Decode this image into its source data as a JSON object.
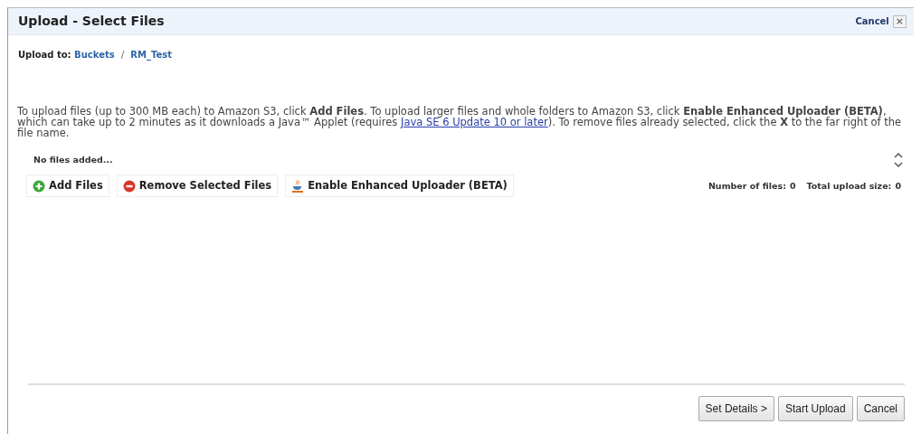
{
  "window": {
    "title": "Upload - Select Files",
    "cancel_link": "Cancel",
    "close_icon": "×"
  },
  "upload_to": {
    "label": "Upload to:",
    "crumbs": [
      "Buckets",
      "RM_Test"
    ],
    "separator": "/"
  },
  "instructions": {
    "before": "To upload files (up to 300 MB each) to Amazon S3, click **Add Files**. To upload larger files and whole folders to Amazon S3, click **Enable Enhanced Uploader (BETA)**, which can take up to 2 minutes as it downloads a Java™ Applet (requires ",
    "link": "Java SE 6 Update 10 or later",
    "after": "). To remove files already selected, click the **X** to the far right of the file name."
  },
  "file_list": {
    "empty_text": "No files added..."
  },
  "actions": [
    {
      "kind": "add",
      "label": "Add Files"
    },
    {
      "kind": "remove",
      "label": "Remove Selected Files"
    },
    {
      "kind": "java",
      "label": "Enable Enhanced Uploader (BETA)"
    }
  ],
  "stats": [
    {
      "label": "Number of files:",
      "value": "0"
    },
    {
      "label": "Total upload size:",
      "value": "0"
    }
  ],
  "footer_buttons": [
    "Set Details >",
    "Start Upload",
    "Cancel"
  ]
}
